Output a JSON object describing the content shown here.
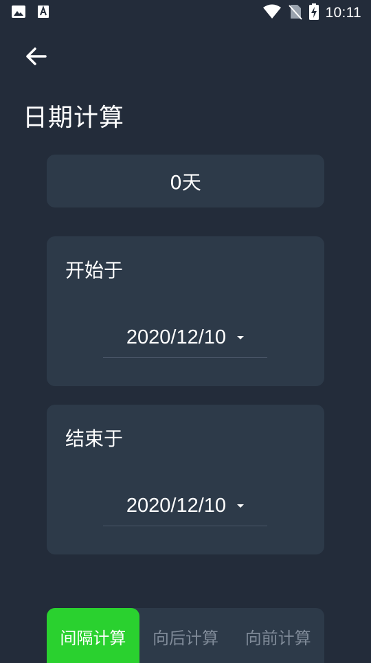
{
  "status_bar": {
    "time": "10:11",
    "icons": [
      "image-icon",
      "font-icon",
      "wifi-icon",
      "no-sim-icon",
      "battery-charging-icon"
    ]
  },
  "header": {
    "back_icon": "arrow-left-icon",
    "title": "日期计算"
  },
  "result": {
    "value": "0天"
  },
  "start": {
    "label": "开始于",
    "date": "2020/12/10"
  },
  "end": {
    "label": "结束于",
    "date": "2020/12/10"
  },
  "tabs": [
    {
      "label": "间隔计算",
      "active": true
    },
    {
      "label": "向后计算",
      "active": false
    },
    {
      "label": "向前计算",
      "active": false
    }
  ],
  "colors": {
    "background": "#232c3a",
    "card": "#2d3a49",
    "accent": "#2ad12f",
    "inactive_text": "#7f8a98"
  }
}
